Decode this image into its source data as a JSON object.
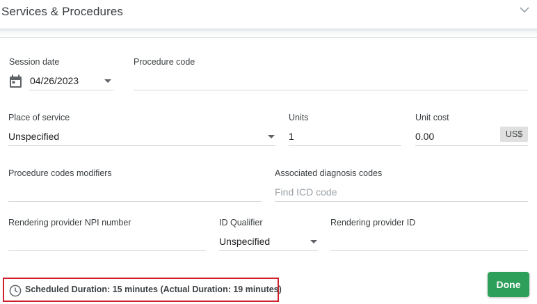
{
  "header": {
    "title": "Services & Procedures"
  },
  "form": {
    "session_date": {
      "label": "Session date",
      "value": "04/26/2023"
    },
    "procedure_code": {
      "label": "Procedure code",
      "value": ""
    },
    "place_of_service": {
      "label": "Place of service",
      "value": "Unspecified"
    },
    "units": {
      "label": "Units",
      "value": "1"
    },
    "unit_cost": {
      "label": "Unit cost",
      "value": "0.00",
      "currency": "US$"
    },
    "procedure_modifiers": {
      "label": "Procedure codes modifiers",
      "value": ""
    },
    "diagnosis_codes": {
      "label": "Associated diagnosis codes",
      "placeholder": "Find ICD code"
    },
    "rendering_npi": {
      "label": "Rendering provider NPI number",
      "value": ""
    },
    "id_qualifier": {
      "label": "ID Qualifier",
      "value": "Unspecified"
    },
    "rendering_provider_id": {
      "label": "Rendering provider ID",
      "value": ""
    }
  },
  "footer": {
    "duration_text": "Scheduled Duration: 15 minutes (Actual Duration: 19 minutes)",
    "done_label": "Done"
  },
  "icons": {
    "collapse": "chevron-down-icon",
    "calendar": "calendar-icon",
    "clock": "clock-icon"
  },
  "colors": {
    "accent_green": "#2e9e5b",
    "highlight_red": "#d0202b"
  }
}
